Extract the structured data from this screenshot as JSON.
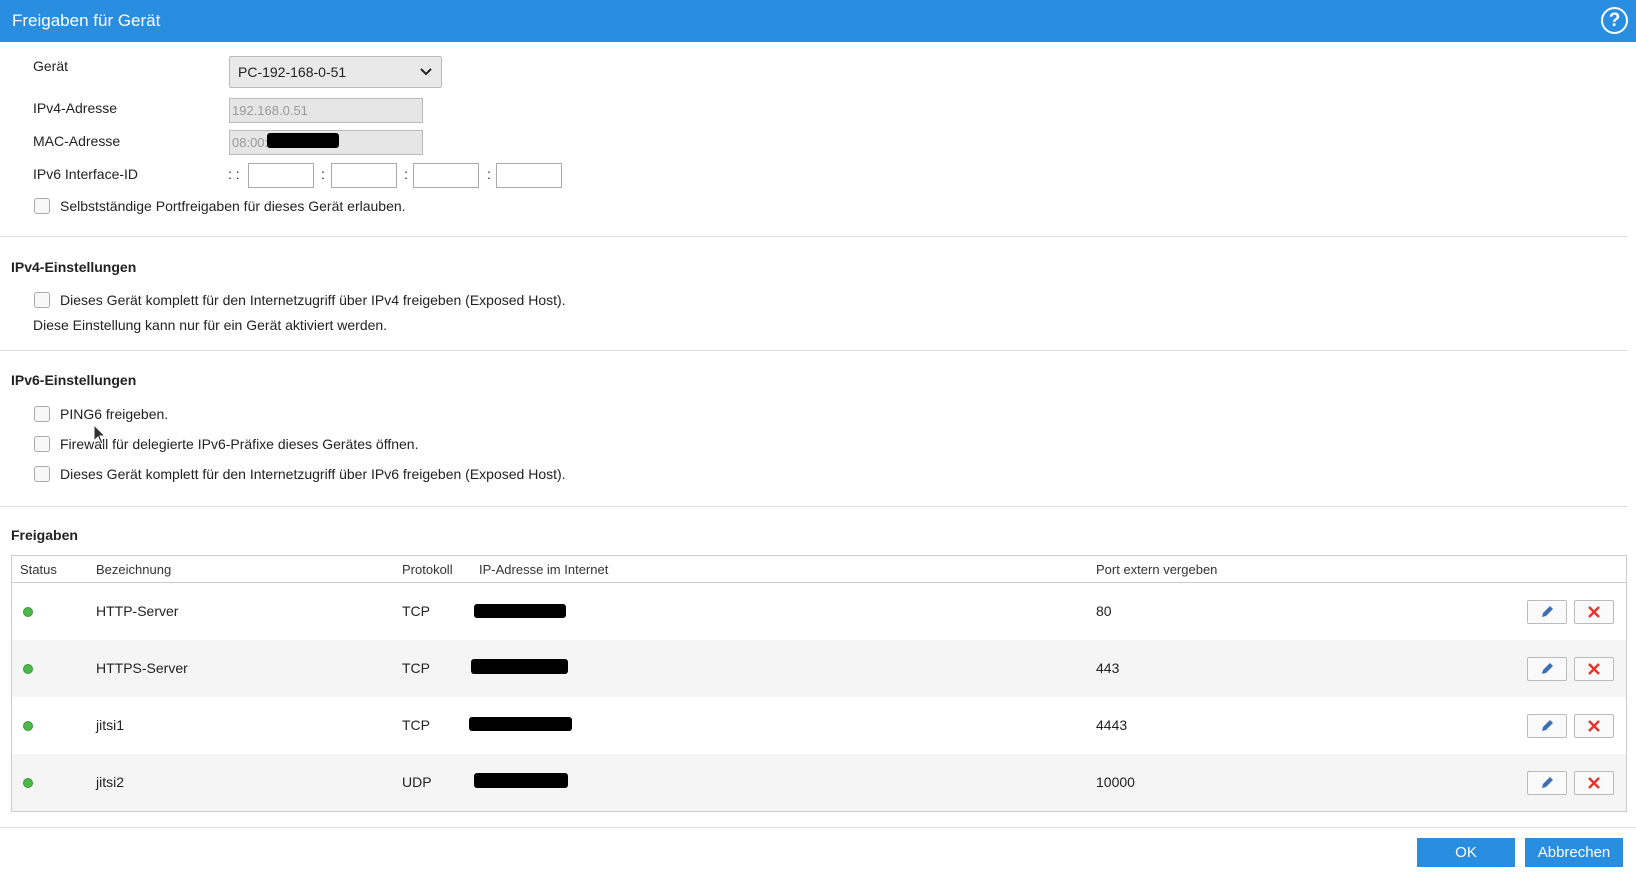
{
  "title": "Freigaben für Gerät",
  "help_label": "?",
  "device": {
    "device_label": "Gerät",
    "device_value": "PC-192-168-0-51",
    "ipv4_label": "IPv4-Adresse",
    "ipv4_value": "192.168.0.51",
    "mac_label": "MAC-Adresse",
    "mac_value": "08:00:",
    "ipv6_label": "IPv6 Interface-ID",
    "ipv6_prefix": ": :",
    "ipv6_sep": ":",
    "self_port_label": "Selbstständige Portfreigaben für dieses Gerät erlauben."
  },
  "ipv4": {
    "title": "IPv4-Einstellungen",
    "exposed_label": "Dieses Gerät komplett für den Internetzugriff über IPv4 freigeben (Exposed Host).",
    "note": "Diese Einstellung kann nur für ein Gerät aktiviert werden."
  },
  "ipv6": {
    "title": "IPv6-Einstellungen",
    "ping6_label": "PING6 freigeben.",
    "firewall_label": "Firewall für delegierte IPv6-Präfixe dieses Gerätes öffnen.",
    "exposed_label": "Dieses Gerät komplett für den Internetzugriff über IPv6 freigeben (Exposed Host)."
  },
  "shares": {
    "title": "Freigaben",
    "columns": [
      "Status",
      "Bezeichnung",
      "Protokoll",
      "IP-Adresse im Internet",
      "Port extern vergeben"
    ],
    "rows": [
      {
        "name": "HTTP-Server",
        "protocol": "TCP",
        "port": "80"
      },
      {
        "name": "HTTPS-Server",
        "protocol": "TCP",
        "port": "443"
      },
      {
        "name": "jitsi1",
        "protocol": "TCP",
        "port": "4443"
      },
      {
        "name": "jitsi2",
        "protocol": "UDP",
        "port": "10000"
      }
    ]
  },
  "footer": {
    "ok_label": "OK",
    "cancel_label": "Abbrechen"
  },
  "colors": {
    "accent": "#2a8ee0",
    "status_ok": "#4cb84a",
    "delete": "#e8322c",
    "edit": "#3b6fb6"
  }
}
